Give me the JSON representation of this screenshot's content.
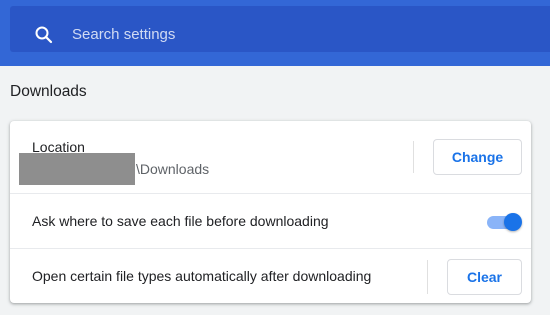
{
  "header": {
    "search_placeholder": "Search settings",
    "search_icon": "search-icon",
    "color": "#3367d6"
  },
  "section": {
    "title": "Downloads"
  },
  "location": {
    "label": "Location",
    "path": "\\Downloads",
    "change_label": "Change"
  },
  "ask_where": {
    "label": "Ask where to save each file before downloading",
    "enabled": true
  },
  "open_types": {
    "label": "Open certain file types automatically after downloading",
    "clear_label": "Clear"
  },
  "colors": {
    "accent": "#1a73e8",
    "header": "#3367d6"
  }
}
